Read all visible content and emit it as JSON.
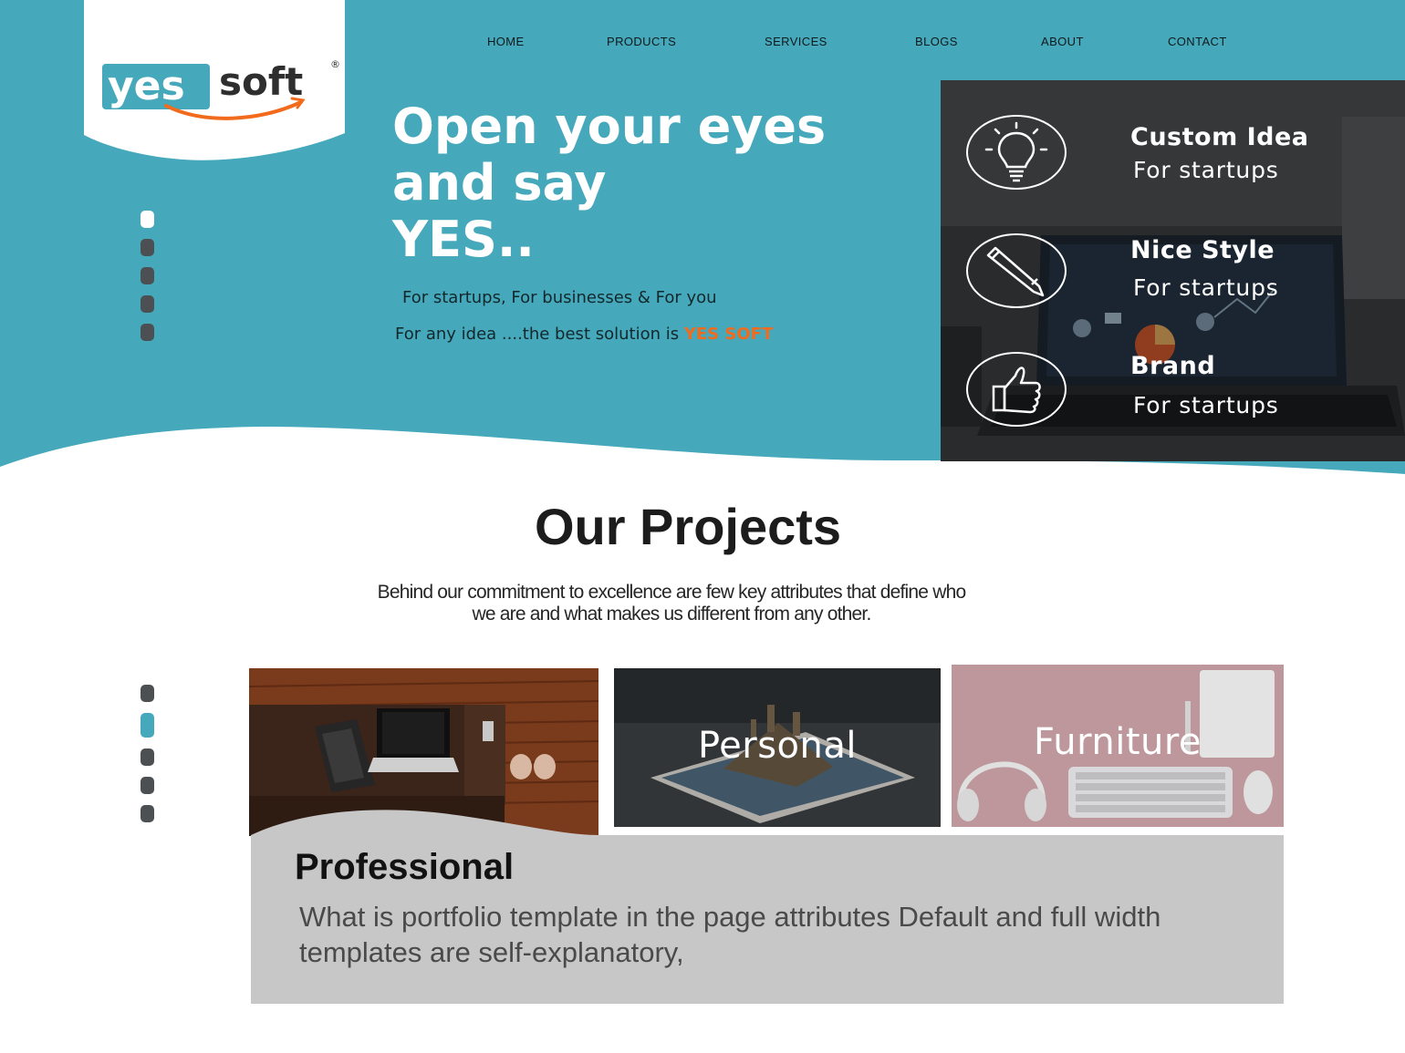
{
  "brand": {
    "logo_word1": "yes",
    "logo_word2": "soft",
    "logo_mark": "®",
    "color_teal": "#45a8bb",
    "color_orange": "#f26b1d",
    "color_dark": "#4d5052"
  },
  "nav": {
    "items": [
      {
        "label": "HOME"
      },
      {
        "label": "PRODUCTS"
      },
      {
        "label": "SERVICES"
      },
      {
        "label": "BLOGS"
      },
      {
        "label": "ABOUT"
      },
      {
        "label": "CONTACT"
      }
    ]
  },
  "hero": {
    "title_line1": "Open your eyes",
    "title_line2": "and say",
    "title_line3": "YES..",
    "subtitle1": "For startups, For businesses & For you",
    "subtitle2_prefix": "For any idea ....the best solution is ",
    "subtitle2_brand": "YES SOFT"
  },
  "slider_top": {
    "count": 5,
    "active_index": 0,
    "active_color": "#ffffff"
  },
  "features": [
    {
      "icon": "lightbulb-icon",
      "title": "Custom Idea",
      "subtitle": "For startups"
    },
    {
      "icon": "pencil-icon",
      "title": "Nice Style",
      "subtitle": "For startups"
    },
    {
      "icon": "thumbs-up-icon",
      "title": "Brand",
      "subtitle": "For startups"
    }
  ],
  "projects": {
    "title": "Our Projects",
    "desc_line1": "Behind our commitment to excellence are few key attributes that define who",
    "desc_line2": "we are and what makes us different from any other.",
    "tiles": [
      {
        "label": "Personal"
      },
      {
        "label": "Furniture"
      }
    ],
    "featured": {
      "title": "Professional",
      "desc": "What is portfolio template in the page attributes Default and full width templates are self-explanatory,"
    }
  },
  "slider_bottom": {
    "count": 5,
    "active_index": 1,
    "active_color": "#45a8bb"
  }
}
